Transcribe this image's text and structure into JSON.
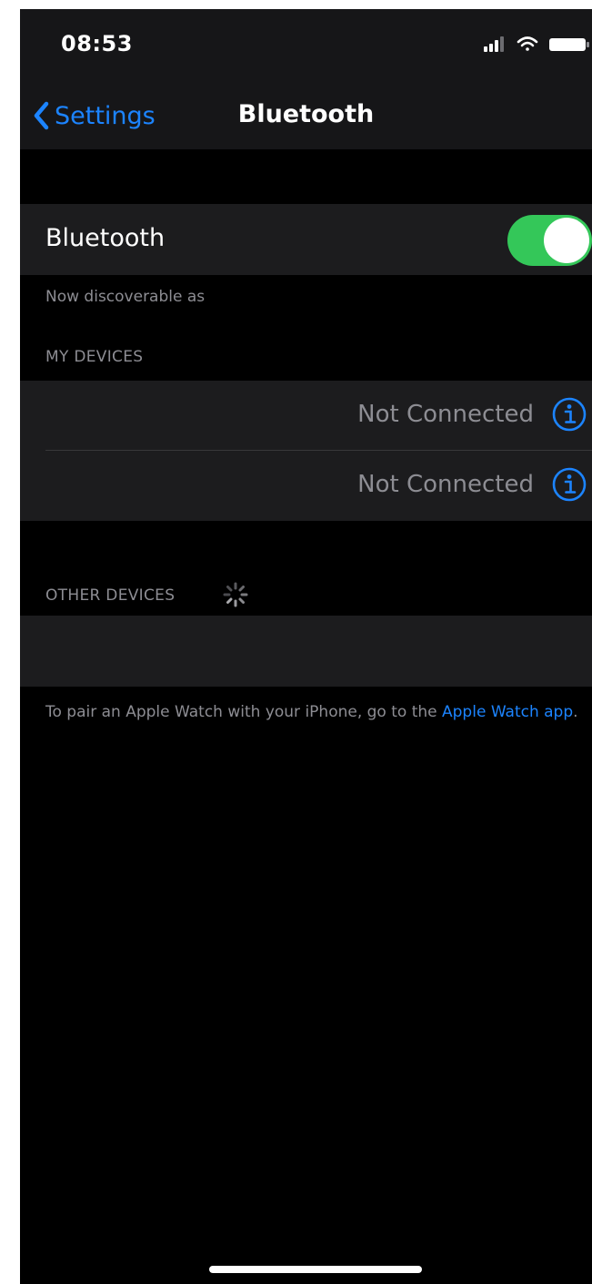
{
  "status_bar": {
    "time": "08:53",
    "icons": [
      "cellular-signal-icon",
      "wifi-icon",
      "battery-icon"
    ]
  },
  "nav": {
    "back_label": "Settings",
    "title": "Bluetooth"
  },
  "bluetooth": {
    "label": "Bluetooth",
    "enabled": true,
    "discoverable_text": "Now discoverable as"
  },
  "my_devices": {
    "header": "MY DEVICES",
    "items": [
      {
        "name": "",
        "status": "Not Connected"
      },
      {
        "name": "",
        "status": "Not Connected"
      }
    ]
  },
  "other_devices": {
    "header": "OTHER DEVICES"
  },
  "footer": {
    "text": "To pair an Apple Watch with your iPhone, go to the ",
    "link": "Apple Watch app",
    "suffix": "."
  },
  "colors": {
    "background": "#000000",
    "cell_background": "#1c1c1e",
    "accent_blue": "#1c84ff",
    "toggle_green": "#34c759",
    "secondary_text": "#8d8d93"
  }
}
